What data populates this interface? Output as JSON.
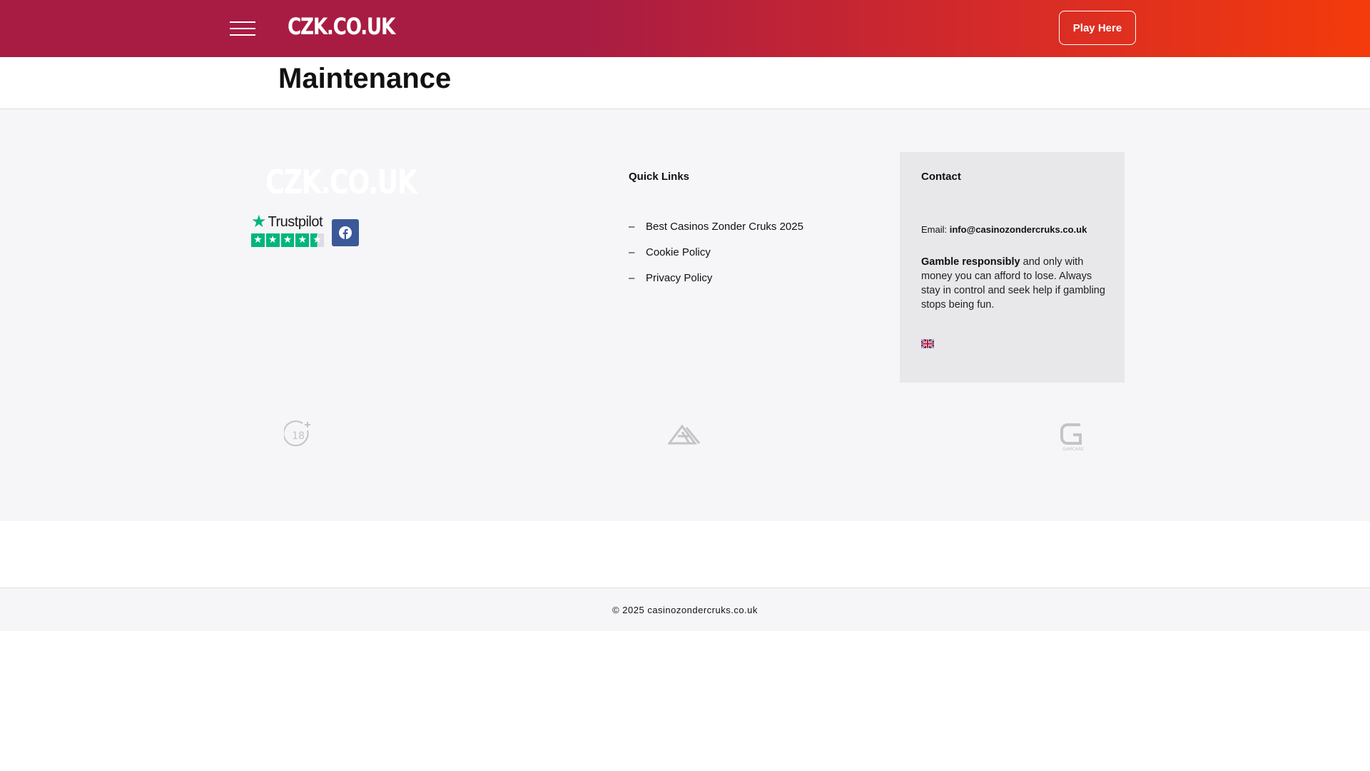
{
  "header": {
    "logo": "CZK.CO.UK",
    "play_button": "Play Here"
  },
  "page": {
    "title": "Maintenance"
  },
  "footer": {
    "logo": "CZK.CO.UK",
    "trustpilot": {
      "label": "Trustpilot",
      "rating_stars": 4.5
    },
    "quick_links": {
      "heading": "Quick Links",
      "items": [
        {
          "dash": "–",
          "label": "Best Casinos Zonder Cruks 2025"
        },
        {
          "dash": "–",
          "label": "Cookie Policy"
        },
        {
          "dash": "–",
          "label": "Privacy Policy"
        }
      ]
    },
    "contact": {
      "heading": "Contact",
      "email_label": "Email:",
      "email": "info@casinozondercruks.co.uk",
      "gamble_bold": "Gamble responsibly",
      "gamble_text": " and only with money you can afford to lose. Always stay in control and seek help if gambling stops being fun."
    },
    "badges": {
      "age": "18",
      "gamcare": "GAMCARE"
    },
    "copyright": "© 2025 casinozondercruks.co.uk"
  },
  "colors": {
    "header_start": "#a81c44",
    "header_end": "#f43b0b",
    "facebook": "#3b5998",
    "trustpilot_green": "#00b67a"
  },
  "icons": {
    "menu": "hamburger-menu-icon",
    "facebook": "facebook-icon",
    "flag": "uk-flag-icon"
  }
}
